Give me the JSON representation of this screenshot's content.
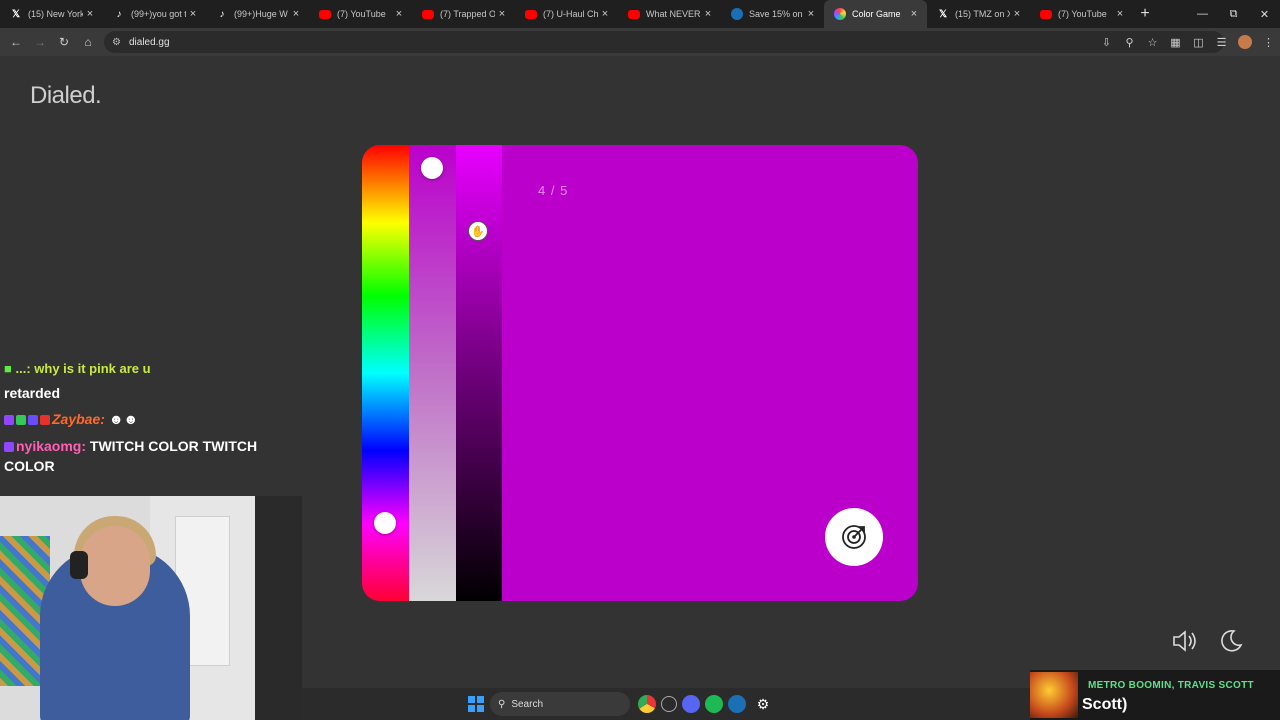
{
  "browser": {
    "tabs": [
      {
        "title": "(15) New York",
        "icon": "x-logo-icon"
      },
      {
        "title": "(99+)you got to",
        "icon": "tiktok-icon"
      },
      {
        "title": "(99+)Huge W",
        "icon": "tiktok-icon"
      },
      {
        "title": "(7) YouTube",
        "icon": "youtube-icon"
      },
      {
        "title": "(7) Trapped On",
        "icon": "youtube-icon"
      },
      {
        "title": "(7) U-Haul Cha",
        "icon": "youtube-icon"
      },
      {
        "title": "What NEVER To",
        "icon": "youtube-icon"
      },
      {
        "title": "Save 15% on C",
        "icon": "steam-icon"
      },
      {
        "title": "Color Game",
        "icon": "color-wheel-icon",
        "active": true
      },
      {
        "title": "(15) TMZ on X",
        "icon": "x-logo-icon"
      },
      {
        "title": "(7) YouTube",
        "icon": "youtube-icon"
      }
    ],
    "url": "dialed.gg"
  },
  "app": {
    "logo": "Dialed.",
    "progress": "4 / 5",
    "target_color": "#bb00cc",
    "hue_slider_level": 0.83,
    "saturation_slider_level": 0.05,
    "brightness_slider_level": 0.19
  },
  "chat": {
    "messages": [
      {
        "user": "",
        "text": "why is it pink are u retarded",
        "clipped_prefix": "...: why is it pink are u"
      },
      {
        "user": "Zaybae:",
        "text": ""
      },
      {
        "user": "nyikaomg:",
        "text": "TWITCH COLOR TWITCH COLOR"
      }
    ],
    "line1_rest": "retarded",
    "line3_cont": "COLOR"
  },
  "taskbar": {
    "search_label": "Search"
  },
  "now_playing": {
    "artist": "METRO BOOMIN, TRAVIS SCOTT",
    "track": "Scott)"
  }
}
